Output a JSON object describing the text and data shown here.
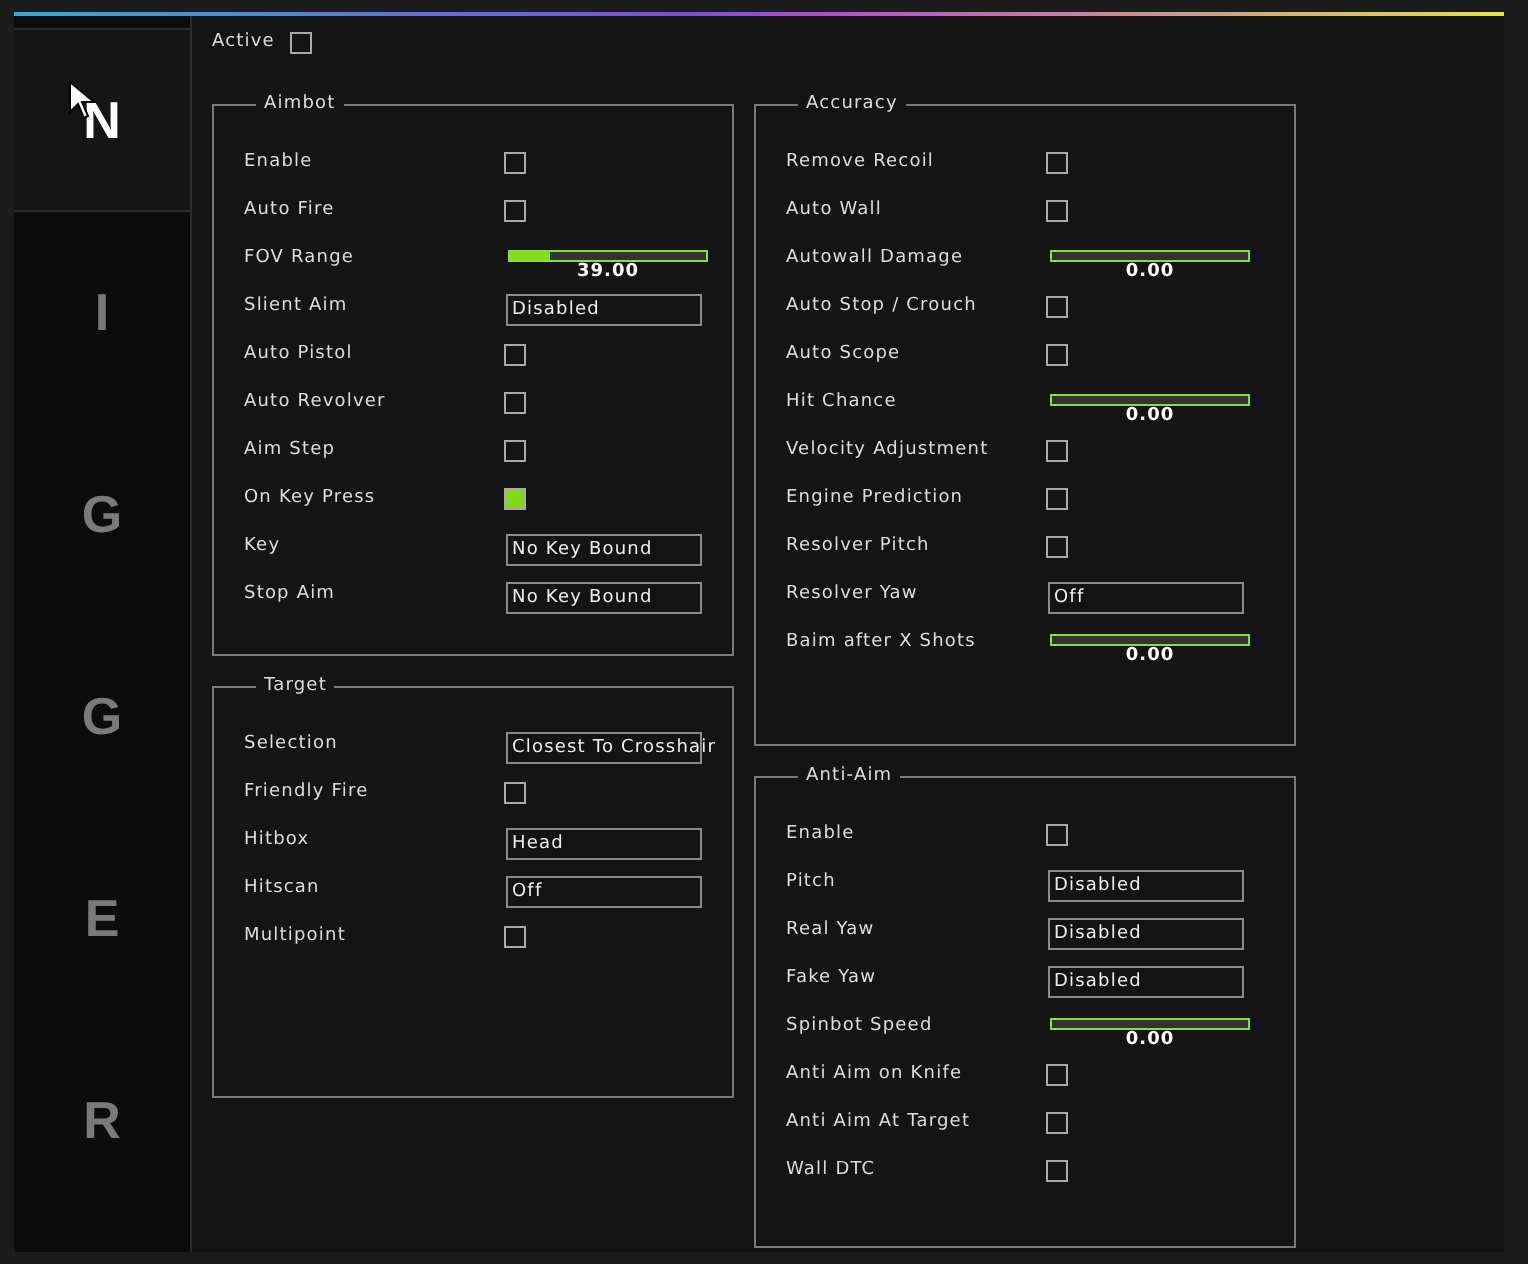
{
  "sidebar": {
    "tabs": [
      {
        "label": "N",
        "selected": true
      },
      {
        "label": "I",
        "selected": false
      },
      {
        "label": "G",
        "selected": false
      },
      {
        "label": "G",
        "selected": false
      },
      {
        "label": "E",
        "selected": false
      },
      {
        "label": "R",
        "selected": false
      }
    ]
  },
  "active": {
    "label": "Active",
    "checked": false
  },
  "columns": [
    {
      "groups": [
        {
          "title": "Aimbot",
          "rows": [
            {
              "kind": "checkbox",
              "label": "Enable",
              "checked": false
            },
            {
              "kind": "checkbox",
              "label": "Auto Fire",
              "checked": false
            },
            {
              "kind": "slider",
              "label": "FOV Range",
              "level": 0.2,
              "reading": "39.00"
            },
            {
              "kind": "dropdown",
              "label": "Slient Aim",
              "value": "Disabled"
            },
            {
              "kind": "checkbox",
              "label": "Auto Pistol",
              "checked": false
            },
            {
              "kind": "checkbox",
              "label": "Auto Revolver",
              "checked": false
            },
            {
              "kind": "checkbox",
              "label": "Aim Step",
              "checked": false
            },
            {
              "kind": "checkbox",
              "label": "On Key Press",
              "checked": true
            },
            {
              "kind": "dropdown",
              "label": "Key",
              "value": "No Key Bound"
            },
            {
              "kind": "dropdown",
              "label": "Stop Aim",
              "value": "No Key Bound"
            }
          ]
        },
        {
          "title": "Target",
          "rows": [
            {
              "kind": "dropdown",
              "label": "Selection",
              "value": "Closest To Crosshair"
            },
            {
              "kind": "checkbox",
              "label": "Friendly Fire",
              "checked": false
            },
            {
              "kind": "dropdown",
              "label": "Hitbox",
              "value": "Head"
            },
            {
              "kind": "dropdown",
              "label": "Hitscan",
              "value": "Off"
            },
            {
              "kind": "checkbox",
              "label": "Multipoint",
              "checked": false
            }
          ]
        }
      ]
    },
    {
      "groups": [
        {
          "title": "Accuracy",
          "rows": [
            {
              "kind": "checkbox",
              "label": "Remove Recoil",
              "checked": false
            },
            {
              "kind": "checkbox",
              "label": "Auto Wall",
              "checked": false
            },
            {
              "kind": "slider",
              "label": "Autowall Damage",
              "level": 0,
              "reading": "0.00"
            },
            {
              "kind": "checkbox",
              "label": "Auto Stop / Crouch",
              "checked": false
            },
            {
              "kind": "checkbox",
              "label": "Auto Scope",
              "checked": false
            },
            {
              "kind": "slider",
              "label": "Hit Chance",
              "level": 0,
              "reading": "0.00"
            },
            {
              "kind": "checkbox",
              "label": "Velocity Adjustment",
              "checked": false
            },
            {
              "kind": "checkbox",
              "label": "Engine Prediction",
              "checked": false
            },
            {
              "kind": "checkbox",
              "label": "Resolver Pitch",
              "checked": false
            },
            {
              "kind": "dropdown",
              "label": "Resolver Yaw",
              "value": "Off"
            },
            {
              "kind": "slider",
              "label": "Baim after X Shots",
              "level": 0,
              "reading": "0.00"
            }
          ]
        },
        {
          "title": "Anti-Aim",
          "rows": [
            {
              "kind": "checkbox",
              "label": "Enable",
              "checked": false
            },
            {
              "kind": "dropdown",
              "label": "Pitch",
              "value": "Disabled"
            },
            {
              "kind": "dropdown",
              "label": "Real Yaw",
              "value": "Disabled"
            },
            {
              "kind": "dropdown",
              "label": "Fake Yaw",
              "value": "Disabled"
            },
            {
              "kind": "slider",
              "label": "Spinbot Speed",
              "level": 0,
              "reading": "0.00"
            },
            {
              "kind": "checkbox",
              "label": "Anti Aim on Knife",
              "checked": false
            },
            {
              "kind": "checkbox",
              "label": "Anti Aim At Target",
              "checked": false
            },
            {
              "kind": "checkbox",
              "label": "Wall DTC",
              "checked": false
            }
          ]
        }
      ]
    }
  ]
}
